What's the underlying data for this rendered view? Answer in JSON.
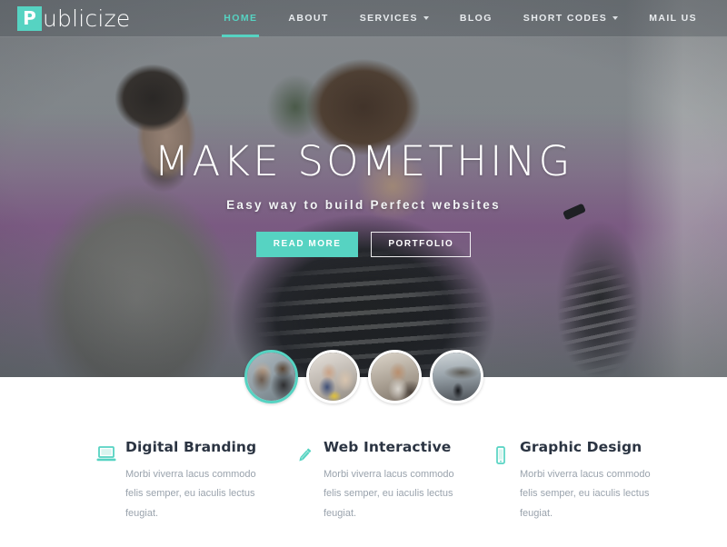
{
  "brand": {
    "mark": "P",
    "name": "ublicize",
    "accent_color": "#56d3c2"
  },
  "nav": {
    "items": [
      {
        "label": "HOME",
        "active": true,
        "has_dropdown": false
      },
      {
        "label": "ABOUT",
        "active": false,
        "has_dropdown": false
      },
      {
        "label": "SERVICES",
        "active": false,
        "has_dropdown": true
      },
      {
        "label": "BLOG",
        "active": false,
        "has_dropdown": false
      },
      {
        "label": "SHORT CODES",
        "active": false,
        "has_dropdown": true
      },
      {
        "label": "MAIL US",
        "active": false,
        "has_dropdown": false
      }
    ]
  },
  "hero": {
    "title": "MAKE SOMETHING",
    "subtitle": "Easy way to build Perfect websites",
    "primary_button": "READ MORE",
    "secondary_button": "PORTFOLIO"
  },
  "thumbnails": [
    {
      "name": "slide-thumb-1",
      "active": true
    },
    {
      "name": "slide-thumb-2",
      "active": false
    },
    {
      "name": "slide-thumb-3",
      "active": false
    },
    {
      "name": "slide-thumb-4",
      "active": false
    }
  ],
  "features": [
    {
      "icon": "laptop-icon",
      "title": "Digital Branding",
      "text": "Morbi viverra lacus commodo felis semper, eu iaculis lectus feugiat."
    },
    {
      "icon": "pencil-icon",
      "title": "Web Interactive",
      "text": "Morbi viverra lacus commodo felis semper, eu iaculis lectus feugiat."
    },
    {
      "icon": "mobile-icon",
      "title": "Graphic Design",
      "text": "Morbi viverra lacus commodo felis semper, eu iaculis lectus feugiat."
    }
  ]
}
